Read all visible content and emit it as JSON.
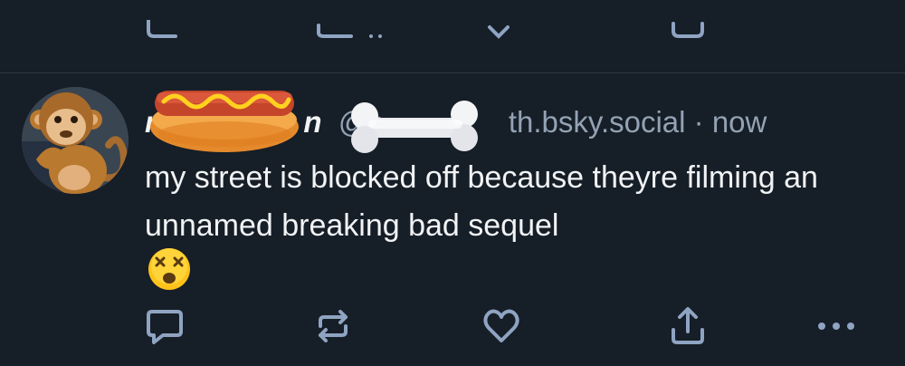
{
  "post": {
    "display_name": "m",
    "display_name_end": "n",
    "handle": "@s",
    "handle_end": "th.bsky.social",
    "separator": " · ",
    "timestamp": "now",
    "text": "my street is blocked off because theyre filming an unnamed breaking bad sequel"
  },
  "icons": {
    "avatar": "monkey-emoji",
    "name_cover": "hotdog-emoji",
    "handle_cover": "bone-emoji",
    "post_emoji": "dizzy-face-emoji",
    "reply": "reply-icon",
    "repost": "repost-icon",
    "like": "heart-icon",
    "share": "share-icon",
    "more": "more-icon"
  },
  "colors": {
    "background": "#161e27",
    "text": "#f1f3f5",
    "muted": "#93a2b4",
    "icon": "#8fa4c2",
    "divider": "#2b3845"
  }
}
